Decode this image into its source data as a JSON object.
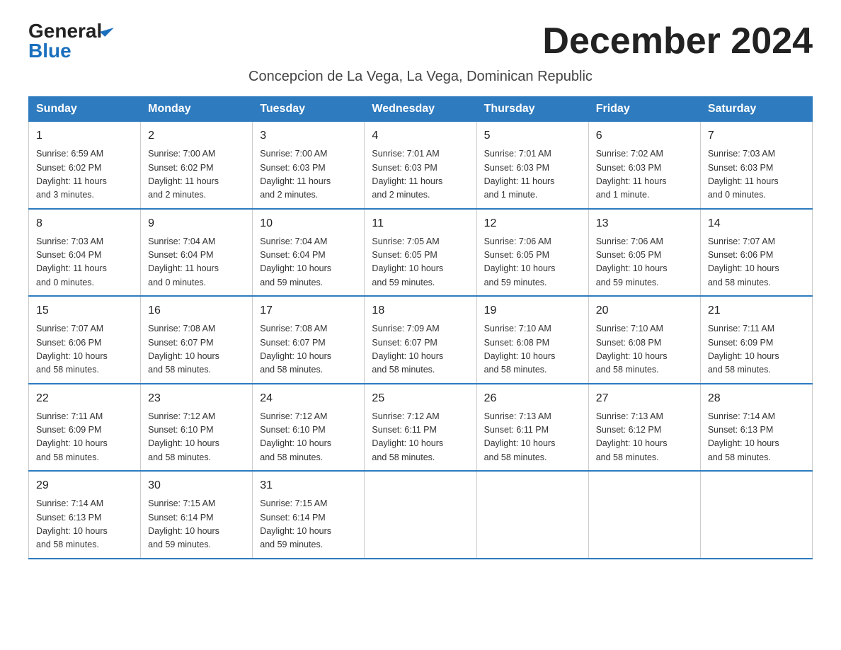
{
  "logo": {
    "general": "General",
    "blue": "Blue",
    "tagline": "GeneralBlue"
  },
  "title": "December 2024",
  "subtitle": "Concepcion de La Vega, La Vega, Dominican Republic",
  "days_header": [
    "Sunday",
    "Monday",
    "Tuesday",
    "Wednesday",
    "Thursday",
    "Friday",
    "Saturday"
  ],
  "weeks": [
    [
      {
        "day": "1",
        "info": "Sunrise: 6:59 AM\nSunset: 6:02 PM\nDaylight: 11 hours\nand 3 minutes."
      },
      {
        "day": "2",
        "info": "Sunrise: 7:00 AM\nSunset: 6:02 PM\nDaylight: 11 hours\nand 2 minutes."
      },
      {
        "day": "3",
        "info": "Sunrise: 7:00 AM\nSunset: 6:03 PM\nDaylight: 11 hours\nand 2 minutes."
      },
      {
        "day": "4",
        "info": "Sunrise: 7:01 AM\nSunset: 6:03 PM\nDaylight: 11 hours\nand 2 minutes."
      },
      {
        "day": "5",
        "info": "Sunrise: 7:01 AM\nSunset: 6:03 PM\nDaylight: 11 hours\nand 1 minute."
      },
      {
        "day": "6",
        "info": "Sunrise: 7:02 AM\nSunset: 6:03 PM\nDaylight: 11 hours\nand 1 minute."
      },
      {
        "day": "7",
        "info": "Sunrise: 7:03 AM\nSunset: 6:03 PM\nDaylight: 11 hours\nand 0 minutes."
      }
    ],
    [
      {
        "day": "8",
        "info": "Sunrise: 7:03 AM\nSunset: 6:04 PM\nDaylight: 11 hours\nand 0 minutes."
      },
      {
        "day": "9",
        "info": "Sunrise: 7:04 AM\nSunset: 6:04 PM\nDaylight: 11 hours\nand 0 minutes."
      },
      {
        "day": "10",
        "info": "Sunrise: 7:04 AM\nSunset: 6:04 PM\nDaylight: 10 hours\nand 59 minutes."
      },
      {
        "day": "11",
        "info": "Sunrise: 7:05 AM\nSunset: 6:05 PM\nDaylight: 10 hours\nand 59 minutes."
      },
      {
        "day": "12",
        "info": "Sunrise: 7:06 AM\nSunset: 6:05 PM\nDaylight: 10 hours\nand 59 minutes."
      },
      {
        "day": "13",
        "info": "Sunrise: 7:06 AM\nSunset: 6:05 PM\nDaylight: 10 hours\nand 59 minutes."
      },
      {
        "day": "14",
        "info": "Sunrise: 7:07 AM\nSunset: 6:06 PM\nDaylight: 10 hours\nand 58 minutes."
      }
    ],
    [
      {
        "day": "15",
        "info": "Sunrise: 7:07 AM\nSunset: 6:06 PM\nDaylight: 10 hours\nand 58 minutes."
      },
      {
        "day": "16",
        "info": "Sunrise: 7:08 AM\nSunset: 6:07 PM\nDaylight: 10 hours\nand 58 minutes."
      },
      {
        "day": "17",
        "info": "Sunrise: 7:08 AM\nSunset: 6:07 PM\nDaylight: 10 hours\nand 58 minutes."
      },
      {
        "day": "18",
        "info": "Sunrise: 7:09 AM\nSunset: 6:07 PM\nDaylight: 10 hours\nand 58 minutes."
      },
      {
        "day": "19",
        "info": "Sunrise: 7:10 AM\nSunset: 6:08 PM\nDaylight: 10 hours\nand 58 minutes."
      },
      {
        "day": "20",
        "info": "Sunrise: 7:10 AM\nSunset: 6:08 PM\nDaylight: 10 hours\nand 58 minutes."
      },
      {
        "day": "21",
        "info": "Sunrise: 7:11 AM\nSunset: 6:09 PM\nDaylight: 10 hours\nand 58 minutes."
      }
    ],
    [
      {
        "day": "22",
        "info": "Sunrise: 7:11 AM\nSunset: 6:09 PM\nDaylight: 10 hours\nand 58 minutes."
      },
      {
        "day": "23",
        "info": "Sunrise: 7:12 AM\nSunset: 6:10 PM\nDaylight: 10 hours\nand 58 minutes."
      },
      {
        "day": "24",
        "info": "Sunrise: 7:12 AM\nSunset: 6:10 PM\nDaylight: 10 hours\nand 58 minutes."
      },
      {
        "day": "25",
        "info": "Sunrise: 7:12 AM\nSunset: 6:11 PM\nDaylight: 10 hours\nand 58 minutes."
      },
      {
        "day": "26",
        "info": "Sunrise: 7:13 AM\nSunset: 6:11 PM\nDaylight: 10 hours\nand 58 minutes."
      },
      {
        "day": "27",
        "info": "Sunrise: 7:13 AM\nSunset: 6:12 PM\nDaylight: 10 hours\nand 58 minutes."
      },
      {
        "day": "28",
        "info": "Sunrise: 7:14 AM\nSunset: 6:13 PM\nDaylight: 10 hours\nand 58 minutes."
      }
    ],
    [
      {
        "day": "29",
        "info": "Sunrise: 7:14 AM\nSunset: 6:13 PM\nDaylight: 10 hours\nand 58 minutes."
      },
      {
        "day": "30",
        "info": "Sunrise: 7:15 AM\nSunset: 6:14 PM\nDaylight: 10 hours\nand 59 minutes."
      },
      {
        "day": "31",
        "info": "Sunrise: 7:15 AM\nSunset: 6:14 PM\nDaylight: 10 hours\nand 59 minutes."
      },
      null,
      null,
      null,
      null
    ]
  ]
}
